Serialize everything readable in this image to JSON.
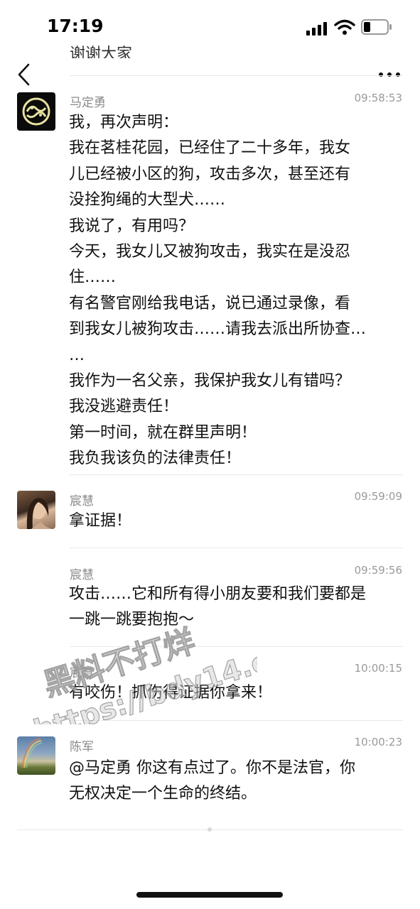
{
  "status_bar": {
    "time": "17:19"
  },
  "nav": {
    "previous_message_fragment": "谢谢大家"
  },
  "messages": [
    {
      "sender": "马定勇",
      "timestamp": "09:58:53",
      "lines": [
        "我，再次声明：",
        "我在茗桂花园，已经住了二十多年，我女",
        "儿已经被小区的狗，攻击多次，甚至还有",
        "没拴狗绳的大型犬……",
        "我说了，有用吗？",
        "今天，我女儿又被狗攻击，我实在是没忍",
        "住……",
        "有名警官刚给我电话，说已通过录像，看",
        "到我女儿被狗攻击……请我去派出所协查…",
        "…",
        "我作为一名父亲，我保护我女儿有错吗？",
        "我没逃避责任！",
        "第一时间，就在群里声明！",
        "我负我该负的法律责任！"
      ]
    },
    {
      "sender": "宸慧",
      "timestamp": "09:59:09",
      "lines": [
        "拿证据！"
      ]
    },
    {
      "sender": "宸慧",
      "timestamp": "09:59:56",
      "lines": [
        "攻击……它和所有得小朋友要和我们要都是",
        "一跳一跳要抱抱～"
      ]
    },
    {
      "sender": "宸慧",
      "timestamp": "10:00:15",
      "lines": [
        "有咬伤！抓伤得证据你拿来！"
      ]
    },
    {
      "sender": "陈军",
      "timestamp": "10:00:23",
      "lines": [
        "@马定勇 你这有点过了。你不是法官，你",
        "无权决定一个生命的终结。"
      ]
    }
  ],
  "watermark": {
    "line1": "黑料不打烊",
    "line2": "https://bdy14.co"
  },
  "colors": {
    "text": "#111111",
    "secondary": "#8a8a8a",
    "separator": "#e9e9e9"
  },
  "icons": [
    "back-chevron-icon",
    "more-dots-icon",
    "signal-icon",
    "wifi-icon",
    "battery-icon"
  ]
}
